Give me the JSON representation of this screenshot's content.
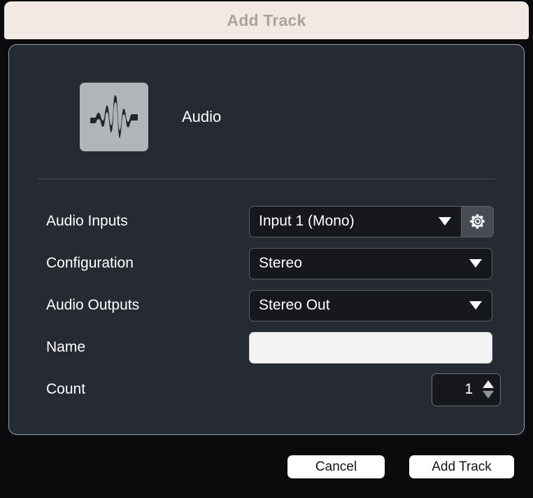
{
  "window": {
    "title": "Add Track"
  },
  "track_type": {
    "icon": "audio-waveform-icon",
    "label": "Audio"
  },
  "form": {
    "rows": [
      {
        "label": "Audio Inputs",
        "control": "select-with-gear",
        "value": "Input 1 (Mono)",
        "gear_icon": "gear-icon"
      },
      {
        "label": "Configuration",
        "control": "select",
        "value": "Stereo"
      },
      {
        "label": "Audio Outputs",
        "control": "select",
        "value": "Stereo Out"
      },
      {
        "label": "Name",
        "control": "text-input",
        "value": "",
        "placeholder": ""
      },
      {
        "label": "Count",
        "control": "stepper",
        "value": "1"
      }
    ]
  },
  "footer": {
    "cancel_label": "Cancel",
    "add_track_label": "Add Track"
  },
  "colors": {
    "titlebar_bg": "#f3e9e4",
    "titlebar_text": "#aba3a0",
    "panel_bg": "#262b33",
    "panel_border": "#9aa0a8",
    "dialog_bg": "#0b0b0d",
    "field_bg": "#16181d",
    "field_border": "#5a6069",
    "gear_btn_bg": "#464b54",
    "text_input_bg": "#f4f4f5",
    "button_bg": "#ffffff",
    "button_text": "#161616",
    "label_text": "#ffffff",
    "icon_tile_bg": "#b1b5ba",
    "waveform": "#22262c"
  }
}
